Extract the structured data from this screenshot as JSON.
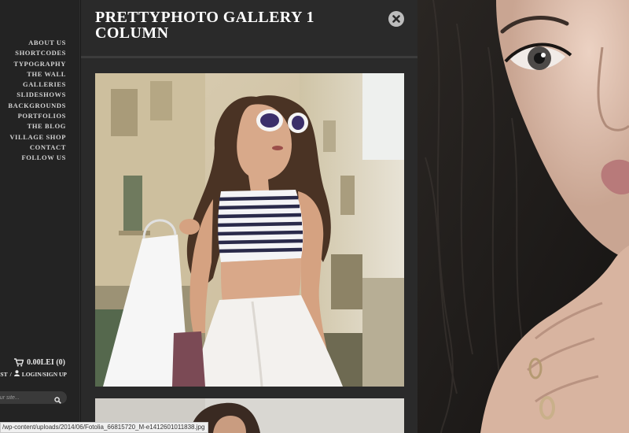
{
  "sidebar": {
    "menu": [
      "ABOUT US",
      "SHORTCODES",
      "TYPOGRAPHY",
      "THE WALL",
      "GALLERIES",
      "SLIDESHOWS",
      "BACKGROUNDS",
      "PORTFOLIOS",
      "THE BLOG",
      "VILLAGE SHOP",
      "CONTACT",
      "FOLLOW US"
    ],
    "cart_total": "0.00LEI (0)",
    "wishlist_label": "HLIST",
    "separator": "/",
    "login_label": "LOGIN/SIGN UP",
    "search_placeholder": "our site..."
  },
  "page": {
    "title": "PRETTYPHOTO GALLERY 1 COLUMN"
  },
  "status_bar": {
    "url": "/wp-content/uploads/2014/06/Fotolia_66815720_M-e1412601011838.jpg"
  },
  "icons": {
    "cart": "cart-icon",
    "user": "user-icon",
    "search": "search-icon",
    "close": "close-icon"
  },
  "colors": {
    "sidebar_bg": "#232323",
    "panel_bg": "#2a2a2a",
    "text": "#ffffff",
    "menu_text": "#d4d4d4",
    "close_button": "#bdbdbd"
  }
}
